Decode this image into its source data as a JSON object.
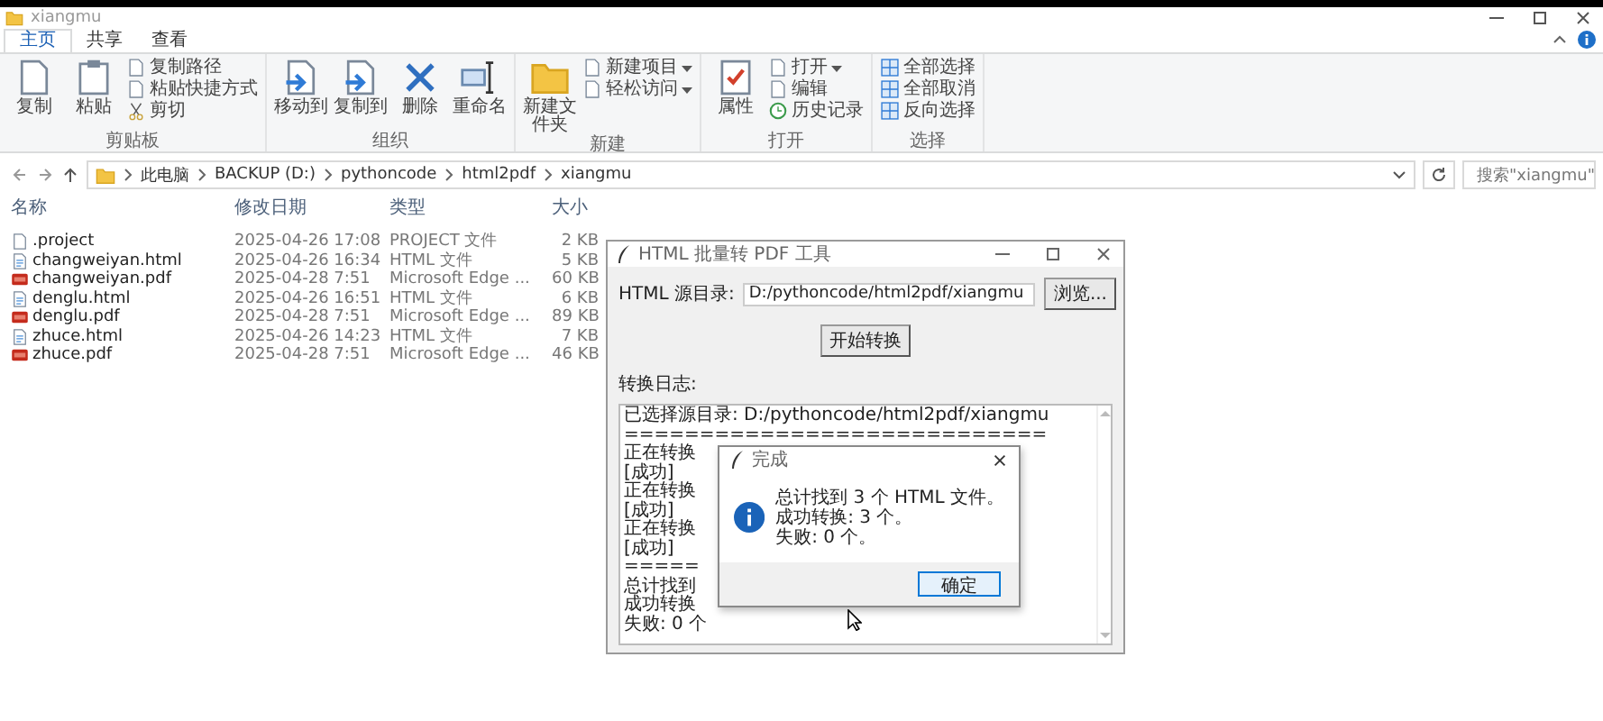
{
  "window": {
    "title": "xiangmu"
  },
  "tabs": [
    {
      "label": "主页",
      "selected": true
    },
    {
      "label": "共享",
      "selected": false
    },
    {
      "label": "查看",
      "selected": false
    }
  ],
  "ribbon": {
    "groups": [
      {
        "label": "剪贴板",
        "items": [
          {
            "label": "复制",
            "kind": "large"
          },
          {
            "label": "粘贴",
            "kind": "large"
          },
          {
            "label": "复制路径",
            "kind": "small"
          },
          {
            "label": "粘贴快捷方式",
            "kind": "small"
          },
          {
            "label": "剪切",
            "kind": "small"
          }
        ]
      },
      {
        "label": "组织",
        "items": [
          {
            "label": "移动到",
            "kind": "large"
          },
          {
            "label": "复制到",
            "kind": "large"
          },
          {
            "label": "删除",
            "kind": "large"
          },
          {
            "label": "重命名",
            "kind": "large"
          }
        ]
      },
      {
        "label": "新建",
        "items": [
          {
            "label": "新建文件夹",
            "kind": "large"
          },
          {
            "label": "新建项目",
            "kind": "small",
            "dropdown": true
          },
          {
            "label": "轻松访问",
            "kind": "small",
            "dropdown": true
          }
        ]
      },
      {
        "label": "打开",
        "items": [
          {
            "label": "属性",
            "kind": "large"
          },
          {
            "label": "打开",
            "kind": "small",
            "dropdown": true
          },
          {
            "label": "编辑",
            "kind": "small"
          },
          {
            "label": "历史记录",
            "kind": "small"
          }
        ]
      },
      {
        "label": "选择",
        "items": [
          {
            "label": "全部选择",
            "kind": "small"
          },
          {
            "label": "全部取消",
            "kind": "small"
          },
          {
            "label": "反向选择",
            "kind": "small"
          }
        ]
      }
    ]
  },
  "address": {
    "path": [
      "此电脑",
      "BACKUP (D:)",
      "pythoncode",
      "html2pdf",
      "xiangmu"
    ]
  },
  "search": {
    "placeholder": "搜索\"xiangmu\""
  },
  "file_list": {
    "columns": [
      "名称",
      "修改日期",
      "类型",
      "大小"
    ],
    "rows": [
      {
        "name": ".project",
        "modified": "2025-04-26 17:08",
        "type": "PROJECT 文件",
        "size": "2 KB",
        "kind": "file"
      },
      {
        "name": "changweiyan.html",
        "modified": "2025-04-26 16:34",
        "type": "HTML 文件",
        "size": "5 KB",
        "kind": "html"
      },
      {
        "name": "changweiyan.pdf",
        "modified": "2025-04-28 7:51",
        "type": "Microsoft Edge ...",
        "size": "60 KB",
        "kind": "pdf"
      },
      {
        "name": "denglu.html",
        "modified": "2025-04-26 16:51",
        "type": "HTML 文件",
        "size": "6 KB",
        "kind": "html"
      },
      {
        "name": "denglu.pdf",
        "modified": "2025-04-28 7:51",
        "type": "Microsoft Edge ...",
        "size": "89 KB",
        "kind": "pdf"
      },
      {
        "name": "zhuce.html",
        "modified": "2025-04-26 14:23",
        "type": "HTML 文件",
        "size": "7 KB",
        "kind": "html"
      },
      {
        "name": "zhuce.pdf",
        "modified": "2025-04-28 7:51",
        "type": "Microsoft Edge ...",
        "size": "46 KB",
        "kind": "pdf"
      }
    ]
  },
  "tool_window": {
    "title": "HTML 批量转 PDF 工具",
    "source_label": "HTML 源目录:",
    "source_value": "D:/pythoncode/html2pdf/xiangmu",
    "browse_button": "浏览...",
    "start_button": "开始转换",
    "log_label": "转换日志:",
    "log_lines": [
      "已选择源目录: D:/pythoncode/html2pdf/xiangmu",
      "============================",
      "正在转换",
      "[成功]",
      "正在转换",
      "[成功]",
      "正在转换",
      "[成功]",
      "=====",
      "总计找到",
      "成功转换",
      "失败: 0 个"
    ]
  },
  "message_dialog": {
    "title": "完成",
    "lines": [
      "总计找到 3 个 HTML 文件。",
      "成功转换: 3 个。",
      "失败: 0 个。"
    ],
    "ok_button": "确定"
  }
}
